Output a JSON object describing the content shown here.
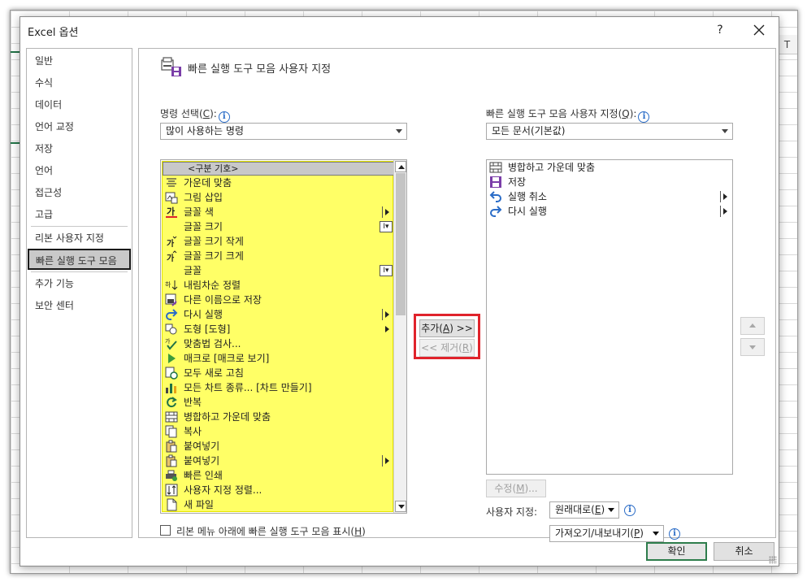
{
  "window": {
    "title": "Excel 옵션",
    "help": "?",
    "sheet_col": "T"
  },
  "sidebar": {
    "items": [
      {
        "label": "일반"
      },
      {
        "label": "수식"
      },
      {
        "label": "데이터"
      },
      {
        "label": "언어 교정"
      },
      {
        "label": "저장"
      },
      {
        "label": "언어"
      },
      {
        "label": "접근성"
      },
      {
        "label": "고급"
      },
      {
        "label": "리본 사용자 지정"
      },
      {
        "label": "빠른 실행 도구 모음",
        "active": true
      },
      {
        "label": "추가 기능"
      },
      {
        "label": "보안 센터"
      }
    ]
  },
  "main": {
    "title": "빠른 실행 도구 모음 사용자 지정",
    "choose_label": "명령 선택(",
    "choose_key": "C",
    "choose_suffix": "):",
    "choose_value": "많이 사용하는 명령",
    "customize_label": "빠른 실행 도구 모음 사용자 지정(",
    "customize_key": "Q",
    "customize_suffix": "):",
    "customize_value": "모든 문서(기본값)",
    "commands": [
      {
        "label": "<구분 기호>",
        "separator": true
      },
      {
        "label": "가운데 맞춤",
        "icon": "align-center-icon"
      },
      {
        "label": "그림 삽입",
        "icon": "insert-picture-icon"
      },
      {
        "label": "글꼴 색",
        "icon": "font-color-icon",
        "submenu": true
      },
      {
        "label": "글꼴 크기",
        "icon": "none",
        "combo": true
      },
      {
        "label": "글꼴 크기 작게",
        "icon": "decrease-font-icon"
      },
      {
        "label": "글꼴 크기 크게",
        "icon": "increase-font-icon"
      },
      {
        "label": "글꼴",
        "icon": "none",
        "combo": true
      },
      {
        "label": "내림차순 정렬",
        "icon": "sort-descending-icon"
      },
      {
        "label": "다른 이름으로 저장",
        "icon": "save-as-icon"
      },
      {
        "label": "다시 실행",
        "icon": "redo-icon",
        "submenu": true
      },
      {
        "label": "도형 [도형]",
        "icon": "shapes-icon",
        "submenu": true
      },
      {
        "label": "맞춤법 검사...",
        "icon": "spelling-icon"
      },
      {
        "label": "매크로 [매크로 보기]",
        "icon": "macro-icon"
      },
      {
        "label": "모두 새로 고침",
        "icon": "refresh-all-icon"
      },
      {
        "label": "모든 차트 종류... [차트 만들기]",
        "icon": "chart-icon"
      },
      {
        "label": "반복",
        "icon": "repeat-icon"
      },
      {
        "label": "병합하고 가운데 맞춤",
        "icon": "merge-center-icon"
      },
      {
        "label": "복사",
        "icon": "copy-icon"
      },
      {
        "label": "붙여넣기",
        "icon": "paste-icon"
      },
      {
        "label": "붙여넣기",
        "icon": "paste-icon",
        "submenu": true
      },
      {
        "label": "빠른 인쇄",
        "icon": "quick-print-icon"
      },
      {
        "label": "사용자 지정 정렬...",
        "icon": "custom-sort-icon"
      },
      {
        "label": "새 파일",
        "icon": "new-file-icon"
      }
    ],
    "add_label": "추가(",
    "add_key": "A",
    "add_suffix": ") >>",
    "remove_label": "<< 제거(",
    "remove_key": "R",
    "remove_suffix": ")",
    "qat_items": [
      {
        "label": "병합하고 가운데 맞춤",
        "icon": "merge-center-icon"
      },
      {
        "label": "저장",
        "icon": "save-icon"
      },
      {
        "label": "실행 취소",
        "icon": "undo-icon",
        "submenu": true
      },
      {
        "label": "다시 실행",
        "icon": "redo-icon",
        "submenu": true
      }
    ],
    "modify_label": "수정(",
    "modify_key": "M",
    "modify_suffix": ")...",
    "custom_label": "사용자 지정:",
    "reset_label": "원래대로(",
    "reset_key": "E",
    "reset_suffix": ")",
    "import_label": "가져오기/내보내기(",
    "import_key": "P",
    "import_suffix": ")",
    "show_below_label": "리본 메뉴 아래에 빠른 실행 도구 모음 표시(",
    "show_below_key": "H",
    "show_below_suffix": ")"
  },
  "footer": {
    "ok": "확인",
    "cancel": "취소"
  },
  "colors": {
    "highlight": "#ffff66",
    "frame": "#e0232b",
    "info": "#2a6cc7",
    "ok_border": "#2e7d4c"
  }
}
